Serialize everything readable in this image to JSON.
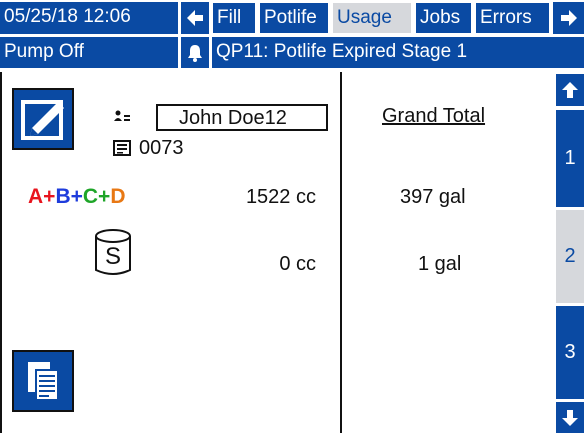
{
  "top_bar": {
    "datetime": "05/25/18 12:06",
    "tabs": [
      {
        "label": "Fill",
        "active": false
      },
      {
        "label": "Potlife",
        "active": false
      },
      {
        "label": "Usage",
        "active": true
      },
      {
        "label": "Jobs",
        "active": false
      },
      {
        "label": "Errors",
        "active": false
      }
    ]
  },
  "status_bar": {
    "pump_status": "Pump Off",
    "alarm_text": "QP11: Potlife Expired Stage 1"
  },
  "usage": {
    "user_name": "John Doe12",
    "job_number": "0073",
    "grand_total_label": "Grand Total",
    "mix_label_parts": [
      {
        "text": "A",
        "color": "#e8141e"
      },
      {
        "text": "+",
        "color": "#e8141e"
      },
      {
        "text": "B",
        "color": "#1e3cdc"
      },
      {
        "text": "+",
        "color": "#1e3cdc"
      },
      {
        "text": "C",
        "color": "#1ea528"
      },
      {
        "text": "+",
        "color": "#1ea528"
      },
      {
        "text": "D",
        "color": "#e87814"
      }
    ],
    "mix_current": "1522 cc",
    "mix_total": "397 gal",
    "solvent_symbol": "S",
    "solvent_current": "0 cc",
    "solvent_total": "1 gal"
  },
  "side_pages": {
    "items": [
      "1",
      "2",
      "3"
    ],
    "selected": "2"
  },
  "colors": {
    "brand_blue": "#0a4aa3",
    "tab_active_bg": "#d6d8dc"
  }
}
